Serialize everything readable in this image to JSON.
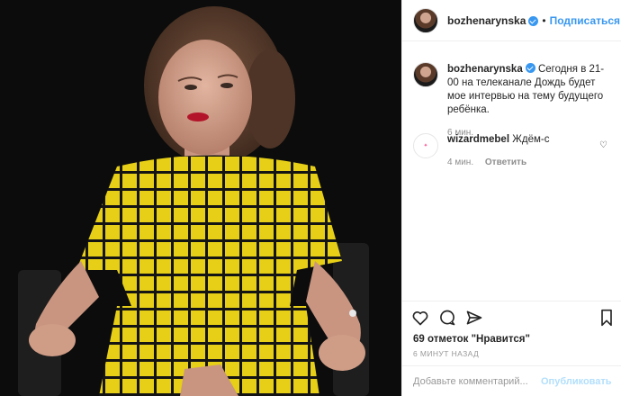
{
  "header": {
    "username": "bozhenarynska",
    "separator": "•",
    "follow_label": "Подписаться"
  },
  "caption": {
    "username": "bozhenarynska",
    "text": "Сегодня в 21-00 на телеканале Дождь будет мое интервью на тему будущего ребёнка.",
    "time": "6 мин."
  },
  "comments": [
    {
      "username": "wizardmebel",
      "text": "Ждём-с",
      "time": "4 мин.",
      "reply_label": "Ответить"
    }
  ],
  "likes": "69 отметок \"Нравится\"",
  "posted_ago": "6 МИНУТ НАЗАД",
  "add_comment": {
    "placeholder": "Добавьте комментарий...",
    "post_label": "Опубликовать"
  },
  "colors": {
    "link_blue": "#3897f0",
    "dress_yellow": "#e8d21a",
    "background": "#0c0c0c"
  },
  "icons": [
    "heart-icon",
    "comment-icon",
    "share-icon",
    "bookmark-icon",
    "verified-icon"
  ]
}
